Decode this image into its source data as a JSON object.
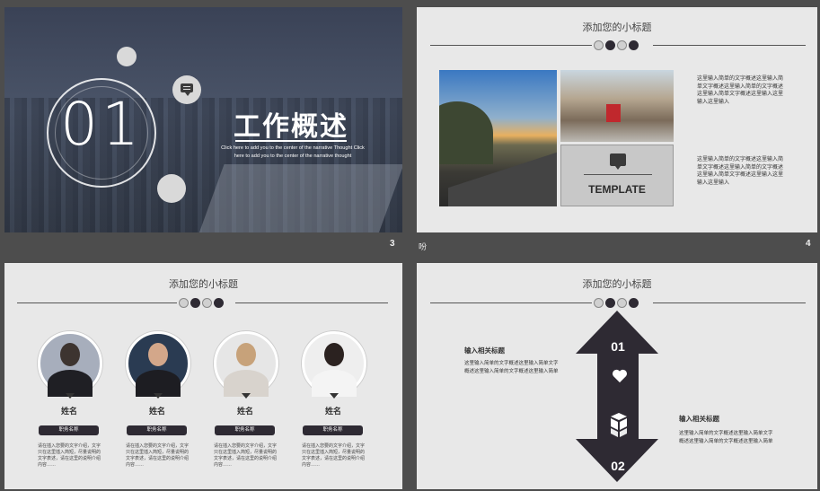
{
  "slides": [
    {
      "number": "3",
      "big_number": "01",
      "title": "工作概述",
      "description": "Click here to add  you to the  center of the  narrative  Thought  Click here to add   you to the  center  of the narrative thought"
    },
    {
      "number": "4",
      "subtitle": "添加您的小标题",
      "template_label": "TEMPLATE",
      "paragraph_1": "这里输入简单的文字概述这里输入简单文字概述这里输入简单的文字概述这里输入简单文字概述这里输入这里输入这里输入",
      "paragraph_2": "这里输入简单的文字概述这里输入简单文字概述这里输入简单的文字概述这里输入简单文字概述这里输入这里输入这里输入"
    },
    {
      "subtitle": "添加您的小标题",
      "people": [
        {
          "name": "姓名",
          "role": "职务名称",
          "desc": "请在插入您要的文字介绍，文字只在这里插入简短，尽量说明的文字表述，请在这里的说明介绍内容……"
        },
        {
          "name": "姓名",
          "role": "职务名称",
          "desc": "请在插入您要的文字介绍，文字只在这里插入简短，尽量说明的文字表述，请在这里的说明介绍内容……"
        },
        {
          "name": "姓名",
          "role": "职务名称",
          "desc": "请在插入您要的文字介绍，文字只在这里插入简短，尽量说明的文字表述，请在这里的说明介绍内容……"
        },
        {
          "name": "姓名",
          "role": "职务名称",
          "desc": "请在插入您要的文字介绍，文字只在这里插入简短，尽量说明的文字表述，请在这里的说明介绍内容……"
        }
      ]
    },
    {
      "subtitle": "添加您的小标题",
      "num_top": "01",
      "num_bottom": "02",
      "left_heading": "输入相关标题",
      "left_text": "这里输入简单的文字概述这里输入简单文字概述这里输入简单的文字概述这里输入简单",
      "right_heading": "输入相关标题",
      "right_text": "这里输入简单的文字概述这里输入简单文字概述这里输入简单的文字概述这里输入简单"
    }
  ],
  "stray_label": "吩"
}
